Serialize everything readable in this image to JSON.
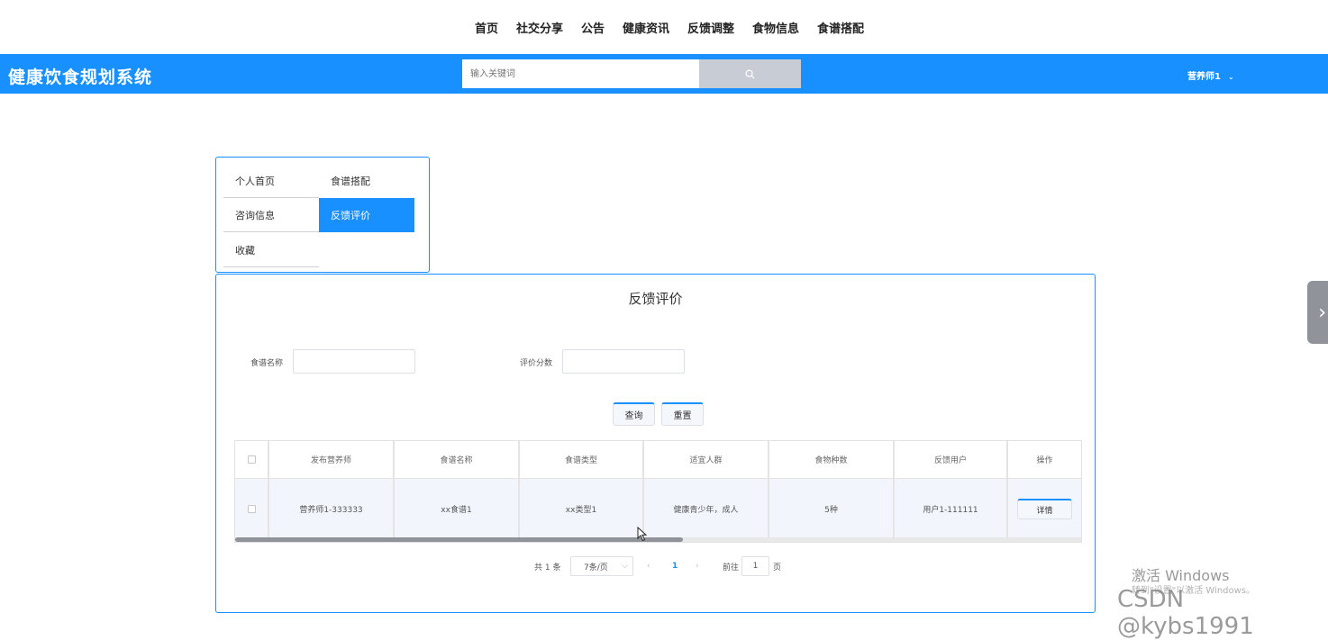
{
  "top_nav": [
    "首页",
    "社交分享",
    "公告",
    "健康资讯",
    "反馈调整",
    "食物信息",
    "食谱搭配"
  ],
  "header": {
    "title": "健康饮食规划系统",
    "search_placeholder": "输入关键词",
    "search_icon": "search-icon",
    "user": "营养师1",
    "user_caret": "⌄"
  },
  "side_menu": [
    {
      "label": "个人首页",
      "active": false
    },
    {
      "label": "食谱搭配",
      "active": false
    },
    {
      "label": "咨询信息",
      "active": false
    },
    {
      "label": "反馈评价",
      "active": true
    },
    {
      "label": "收藏",
      "active": false
    }
  ],
  "main": {
    "title": "反馈评价",
    "filter_recipe_label": "食谱名称",
    "filter_score_label": "评价分数",
    "query_button": "查询",
    "reset_button": "重置"
  },
  "table": {
    "columns": [
      "发布营养师",
      "食谱名称",
      "食谱类型",
      "适宜人群",
      "食物种数",
      "反馈用户",
      "操作"
    ],
    "rows": [
      [
        "营养师1-333333",
        "xx食谱1",
        "xx类型1",
        "健康青少年，成人",
        "5种",
        "用户1-111111"
      ]
    ],
    "detail_button": "详情"
  },
  "pagination": {
    "total": "共 1 条",
    "page_size": "7条/页",
    "current_page": "1",
    "goto_label": "前往",
    "goto_value": "1",
    "page_suffix": "页"
  },
  "watermarks": {
    "activate": "激活 Windows",
    "activate_hint": "转到\"设置\"以激活 Windows。",
    "csdn": "CSDN @kybs1991"
  },
  "colors": {
    "accent": "#1890ff",
    "search_button": "#c8ccd4"
  }
}
